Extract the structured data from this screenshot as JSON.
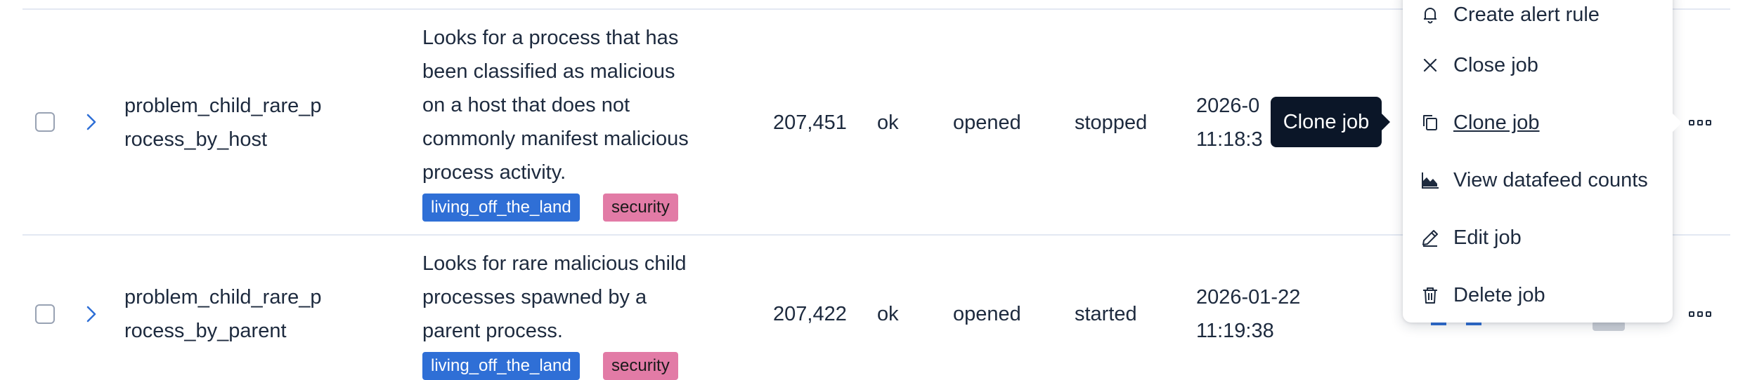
{
  "rows": [
    {
      "id_line1": "problem_child_rare_p",
      "id_line2": "rocess_by_host",
      "description": [
        "Looks for a process that has",
        "been classified as malicious",
        "on a host that does not",
        "commonly manifest malicious",
        "process activity."
      ],
      "groups": [
        "living_off_the_land",
        "security"
      ],
      "processed_records": "207,451",
      "memory_status": "ok",
      "job_state": "opened",
      "datafeed_state": "stopped",
      "latest_timestamp_line1": "2026-0",
      "latest_timestamp_line2": "11:18:3"
    },
    {
      "id_line1": "problem_child_rare_p",
      "id_line2": "rocess_by_parent",
      "description": [
        "Looks for rare malicious child",
        "processes spawned by a",
        "parent process."
      ],
      "groups": [
        "living_off_the_land",
        "security"
      ],
      "processed_records": "207,422",
      "memory_status": "ok",
      "job_state": "opened",
      "datafeed_state": "started",
      "latest_timestamp_line1": "2026-01-22",
      "latest_timestamp_line2": "11:19:38"
    }
  ],
  "menu": {
    "items": [
      {
        "label": "Create alert rule",
        "icon": "bell-icon"
      },
      {
        "label": "Close job",
        "icon": "close-icon"
      },
      {
        "label": "Clone job",
        "icon": "copy-icon"
      },
      {
        "label": "View datafeed counts",
        "icon": "chart-area-icon"
      },
      {
        "label": "Edit job",
        "icon": "pencil-icon"
      },
      {
        "label": "Delete job",
        "icon": "trash-icon"
      }
    ]
  },
  "tooltip": {
    "text": "Clone job"
  },
  "colors": {
    "badge_blue": "#2f6fd6",
    "badge_pink": "#e27ba6",
    "tooltip_bg": "#0b1628",
    "text": "#1d2a3e"
  }
}
